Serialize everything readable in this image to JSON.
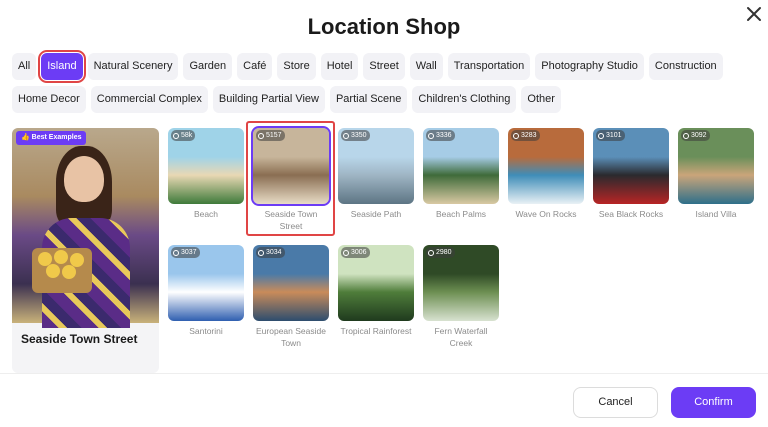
{
  "title": "Location Shop",
  "chips_row1": [
    {
      "label": "All",
      "active": false
    },
    {
      "label": "Island",
      "active": true
    },
    {
      "label": "Natural Scenery",
      "active": false
    },
    {
      "label": "Garden",
      "active": false
    },
    {
      "label": "Café",
      "active": false
    },
    {
      "label": "Store",
      "active": false
    },
    {
      "label": "Hotel",
      "active": false
    },
    {
      "label": "Street",
      "active": false
    },
    {
      "label": "Wall",
      "active": false
    },
    {
      "label": "Transportation",
      "active": false
    },
    {
      "label": "Photography Studio",
      "active": false
    },
    {
      "label": "Construction",
      "active": false
    }
  ],
  "chips_row2": [
    {
      "label": "Home Decor"
    },
    {
      "label": "Commercial Complex"
    },
    {
      "label": "Building Partial View"
    },
    {
      "label": "Partial Scene"
    },
    {
      "label": "Children's Clothing"
    },
    {
      "label": "Other"
    }
  ],
  "example": {
    "badge": "Best Examples",
    "label": "Seaside Town Street"
  },
  "locations": [
    {
      "name": "Beach",
      "count": "58k",
      "colors": [
        "#9fd3e8",
        "#e9d8b4",
        "#3e7a3a"
      ],
      "selected": false
    },
    {
      "name": "Seaside Town Street",
      "count": "5157",
      "colors": [
        "#c7b59b",
        "#8a6e52",
        "#e8dcc6"
      ],
      "selected": true
    },
    {
      "name": "Seaside Path",
      "count": "3350",
      "colors": [
        "#b8d6ea",
        "#9fb5c4",
        "#5d7584"
      ],
      "selected": false
    },
    {
      "name": "Beach Palms",
      "count": "3336",
      "colors": [
        "#a6cce6",
        "#3f6b3a",
        "#d9c9a3"
      ],
      "selected": false
    },
    {
      "name": "Wave On Rocks",
      "count": "3283",
      "colors": [
        "#b86b3c",
        "#3f8db8",
        "#e9f1f5"
      ],
      "selected": false
    },
    {
      "name": "Sea Black Rocks",
      "count": "3101",
      "colors": [
        "#5b8fb8",
        "#2a2a2e",
        "#b82525"
      ],
      "selected": false
    },
    {
      "name": "Island Villa",
      "count": "3092",
      "colors": [
        "#6a8f5a",
        "#caa57a",
        "#2e6f8a"
      ],
      "selected": false
    },
    {
      "name": "Santorini",
      "count": "3037",
      "colors": [
        "#9ac6ec",
        "#ffffff",
        "#2f5fb0"
      ],
      "selected": false
    },
    {
      "name": "European Seaside Town",
      "count": "3034",
      "colors": [
        "#4a7aa8",
        "#c98b5a",
        "#2d4d6e"
      ],
      "selected": false
    },
    {
      "name": "Tropical Rainforest",
      "count": "3006",
      "colors": [
        "#cfe3c0",
        "#4f7d3a",
        "#1f3a1e"
      ],
      "selected": false
    },
    {
      "name": "Fern Waterfall Creek",
      "count": "2980",
      "colors": [
        "#2f4a26",
        "#6d8f52",
        "#d8e2d0"
      ],
      "selected": false
    }
  ],
  "buttons": {
    "cancel": "Cancel",
    "confirm": "Confirm"
  },
  "colors": {
    "accent": "#6c3cf5",
    "highlight": "#e04545"
  }
}
